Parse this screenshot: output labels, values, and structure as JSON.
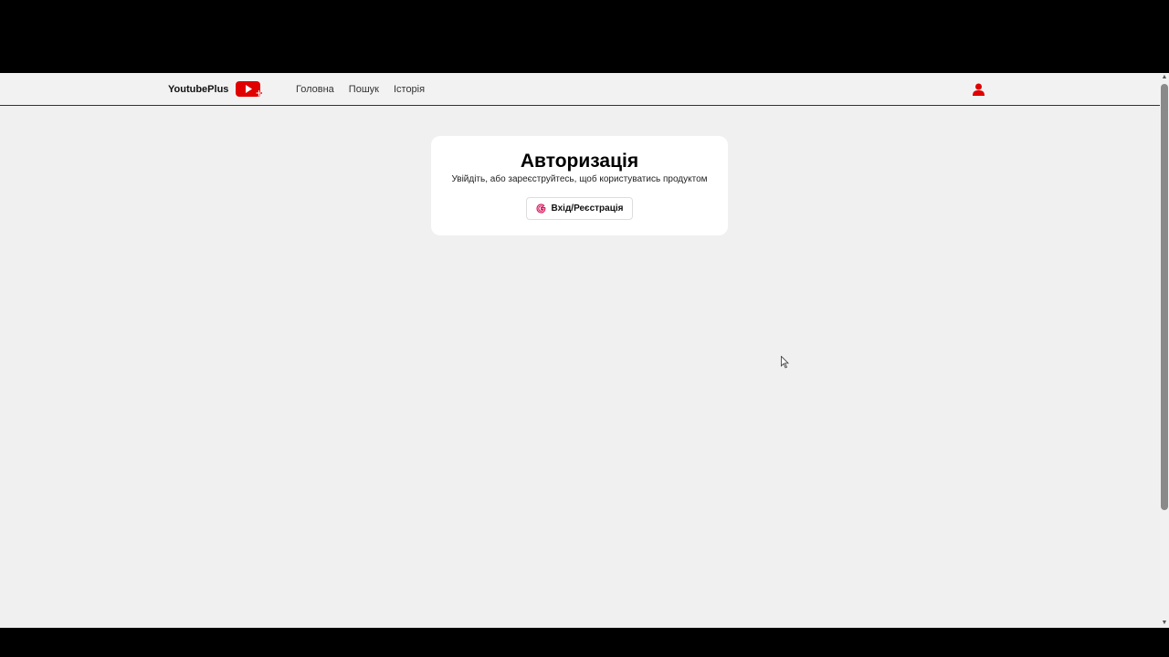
{
  "brand": {
    "name": "YoutubePlus",
    "logo_icon": "youtube-plus-logo-icon"
  },
  "nav": {
    "links": [
      {
        "label": "Головна"
      },
      {
        "label": "Пошук"
      },
      {
        "label": "Історія"
      }
    ],
    "user_icon": "user-icon"
  },
  "auth": {
    "title": "Авторизація",
    "subtitle": "Увійдіть, або зареєструйтесь, щоб користуватись продуктом",
    "button_label": "Вхід/Реєстрація",
    "button_icon": "google-icon"
  },
  "colors": {
    "accent": "#e00000",
    "background": "#f0f0f0",
    "card": "#ffffff"
  }
}
